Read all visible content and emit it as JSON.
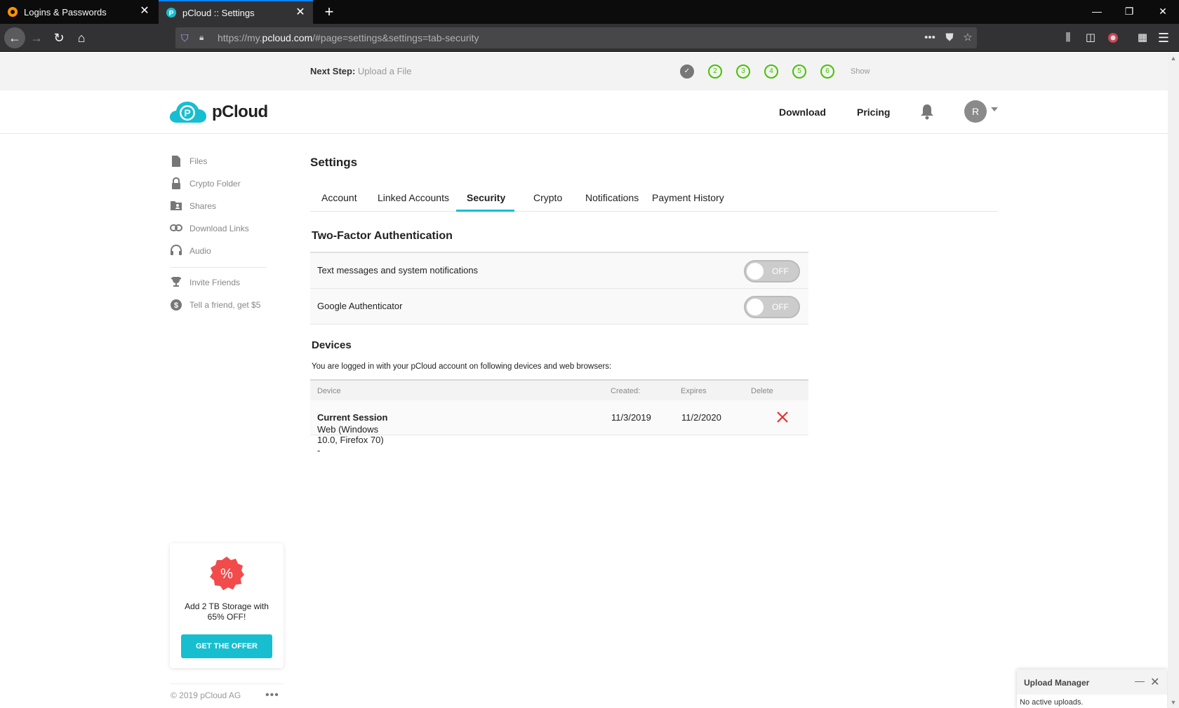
{
  "browser": {
    "tabs": [
      {
        "title": "Logins & Passwords"
      },
      {
        "title": "pCloud :: Settings"
      }
    ],
    "url_prefix": "https://my.",
    "url_domain": "pcloud.com",
    "url_suffix": "/#page=settings&settings=tab-security"
  },
  "next_step": {
    "label": "Next Step:",
    "value": "Upload a File",
    "steps": [
      "2",
      "3",
      "4",
      "5",
      "6"
    ],
    "show_label": "Show"
  },
  "header": {
    "brand": "pCloud",
    "download": "Download",
    "pricing": "Pricing",
    "avatar_letter": "R"
  },
  "sidebar": {
    "items": [
      {
        "label": "Files",
        "icon": "file-icon"
      },
      {
        "label": "Crypto Folder",
        "icon": "lock-icon"
      },
      {
        "label": "Shares",
        "icon": "shared-folder-icon"
      },
      {
        "label": "Download Links",
        "icon": "link-icon"
      },
      {
        "label": "Audio",
        "icon": "headphones-icon"
      }
    ],
    "extra": [
      {
        "label": "Invite Friends",
        "icon": "trophy-icon"
      },
      {
        "label": "Tell a friend, get $5",
        "icon": "dollar-icon"
      }
    ],
    "offer": {
      "badge": "%",
      "line1": "Add 2 TB Storage with",
      "line2": "65% OFF!",
      "button": "GET THE OFFER"
    },
    "copyright": "© 2019 pCloud AG"
  },
  "settings": {
    "title": "Settings",
    "tabs": [
      "Account",
      "Linked Accounts",
      "Security",
      "Crypto",
      "Notifications",
      "Payment History"
    ],
    "active_tab": "Security"
  },
  "two_factor": {
    "heading": "Two-Factor Authentication",
    "rows": [
      {
        "label": "Text messages and system notifications",
        "state": "OFF"
      },
      {
        "label": "Google Authenticator",
        "state": "OFF"
      }
    ]
  },
  "devices": {
    "heading": "Devices",
    "subtitle": "You are logged in with your pCloud account on following devices and web browsers:",
    "columns": [
      "Device",
      "Created:",
      "Expires",
      "Delete"
    ],
    "rows": [
      {
        "device": "Web (Windows 10.0, Firefox 70) - ",
        "session": "Current Session",
        "created": "11/3/2019",
        "expires": "11/2/2020"
      }
    ]
  },
  "upload_manager": {
    "title": "Upload Manager",
    "status": "No active uploads."
  },
  "colors": {
    "accent": "#17bed0",
    "step_green": "#46c200",
    "delete_red": "#e5322d"
  }
}
